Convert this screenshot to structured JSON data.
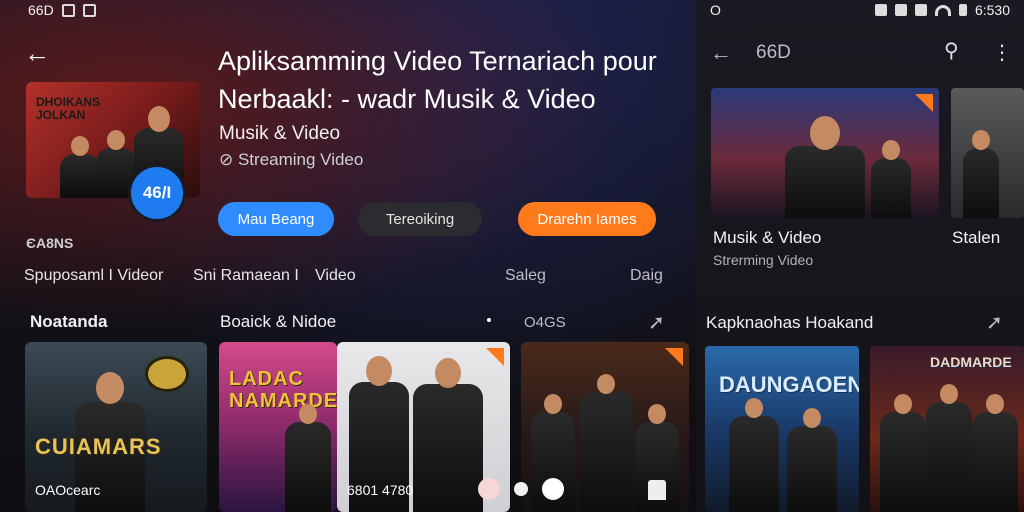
{
  "status": {
    "left_text": "66D",
    "right_time": "6:530"
  },
  "header": {
    "title_line1": "Apliksamming Video Ternariach pour",
    "title_line2": "Nerbaakl: - wadr Musik & Video",
    "subtitle": "Musik & Video",
    "streaming": "Streaming Video"
  },
  "cover": {
    "title": "DHOIKANS JOLKAN",
    "badge": "46/I"
  },
  "buttons": {
    "primary": "Mau Beang",
    "secondary": "Tereoiking",
    "accent": "Drarehn Iames"
  },
  "section_small": "ЄA8NS",
  "row_labels": [
    "Spuposaml I Videor",
    "Sni Ramaean I",
    "Video",
    "Saleg",
    "Daig"
  ],
  "categories": {
    "left": "Noatanda",
    "mid": "Boaick & Nidoe",
    "mid_extra": "O4GS"
  },
  "cards": [
    {
      "label": "CUIAMARS",
      "bottom_text": "OAOcearc"
    },
    {
      "label": "LADAC NAMARDE",
      "bottom_text": ""
    },
    {
      "label": "",
      "bottom_text": "6801 4780"
    },
    {
      "label": "",
      "bottom_text": ""
    }
  ],
  "right_panel": {
    "status_left": "O",
    "title": "66D",
    "card1_name": "Musik & Video",
    "card1_sub": "Strerming Video",
    "card2_name": "Stalen",
    "section": "Kapknaohas Hoakand",
    "card3_label": "DAUNGAOEN",
    "card4_label": "DADMARDE"
  },
  "colors": {
    "blue": "#2f8cff",
    "orange": "#ff7a1a",
    "dark_pill": "#2b2b30"
  }
}
